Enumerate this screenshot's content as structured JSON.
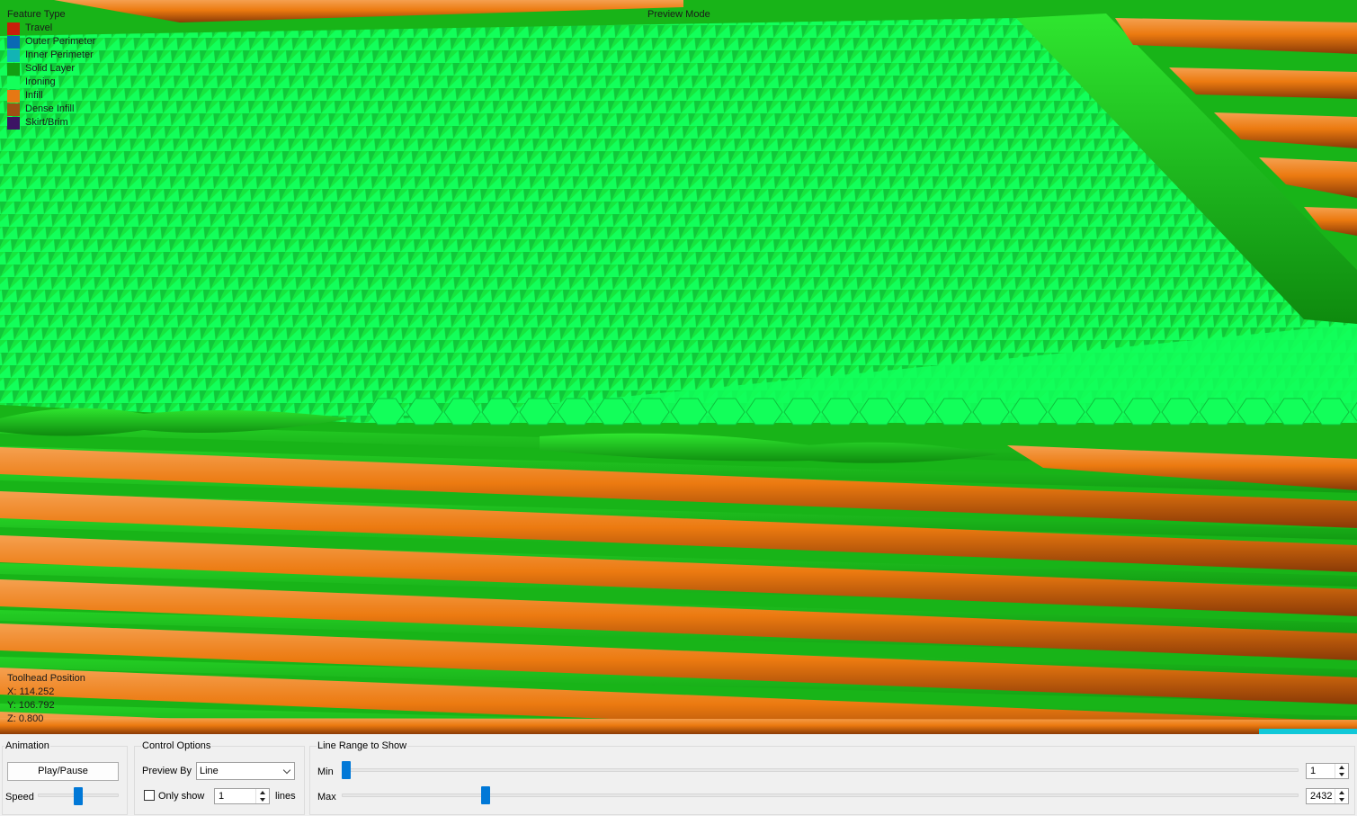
{
  "legend": {
    "title": "Feature Type",
    "items": [
      {
        "label": "Travel",
        "color": "#c81e0a",
        "icon": "travel-swatch"
      },
      {
        "label": "Outer Perimeter",
        "color": "#0a6ab4",
        "icon": "outer-perimeter-swatch"
      },
      {
        "label": "Inner Perimeter",
        "color": "#12b4b4",
        "icon": "inner-perimeter-swatch"
      },
      {
        "label": "Solid Layer",
        "color": "#12a012",
        "icon": "solid-layer-swatch"
      },
      {
        "label": "Ironing",
        "color": "#14ff5a",
        "icon": "ironing-swatch"
      },
      {
        "label": "Infill",
        "color": "#e67814",
        "icon": "infill-swatch"
      },
      {
        "label": "Dense Infill",
        "color": "#a05014",
        "icon": "dense-infill-swatch"
      },
      {
        "label": "Skirt/Brim",
        "color": "#3c1464",
        "icon": "skirt-brim-swatch"
      }
    ]
  },
  "viewport": {
    "mode_label": "Preview Mode",
    "colors": {
      "solid": "#18b418",
      "ironing": "#12ff5a",
      "infill": "#ec7a10",
      "infill_dark": "#8a3a06",
      "solid_dark": "#0e8a0e"
    }
  },
  "toolhead": {
    "title": "Toolhead Position",
    "x": "X: 114.252",
    "y": "Y: 106.792",
    "z": "Z: 0.800"
  },
  "animation": {
    "title": "Animation",
    "play_pause_label": "Play/Pause",
    "speed_label": "Speed",
    "speed_value": 0.5
  },
  "control_options": {
    "title": "Control Options",
    "preview_by_label": "Preview By",
    "preview_by_value": "Line",
    "only_show_label": "Only show",
    "only_show_checked": false,
    "only_show_value": "1",
    "lines_label": "lines"
  },
  "line_range": {
    "title": "Line Range to Show",
    "min_label": "Min",
    "min_value": "1",
    "max_label": "Max",
    "max_value": "2432",
    "min_fraction": 0.0,
    "max_fraction": 0.146
  }
}
